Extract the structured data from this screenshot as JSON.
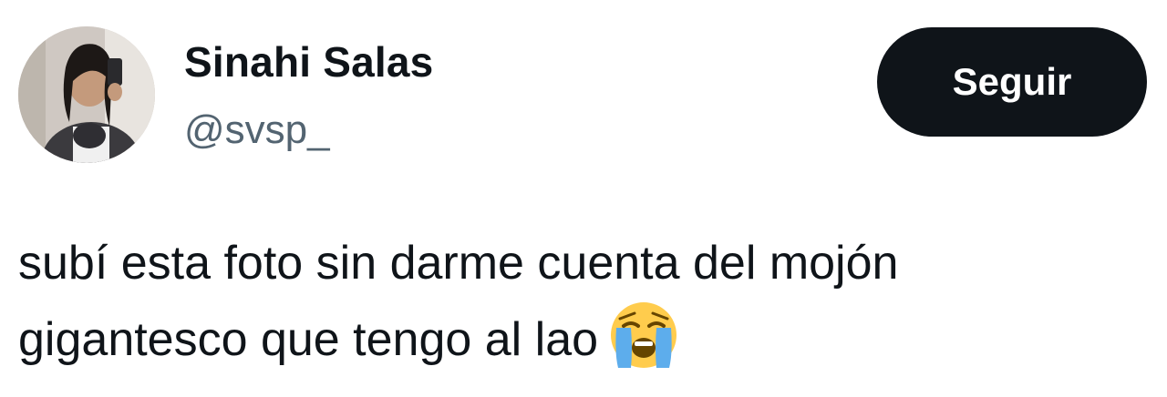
{
  "user": {
    "display_name": "Sinahi Salas",
    "handle": "@svsp_",
    "avatar_icon": "profile-photo"
  },
  "follow_button": {
    "label": "Seguir"
  },
  "tweet": {
    "line1": "subí esta foto sin darme cuenta del mojón",
    "line2": "gigantesco que tengo al lao",
    "emoji_icon": "loudly-crying-face-emoji"
  },
  "colors": {
    "text": "#0f1419",
    "secondary": "#536471",
    "button_bg": "#0f1419",
    "button_text": "#ffffff"
  }
}
